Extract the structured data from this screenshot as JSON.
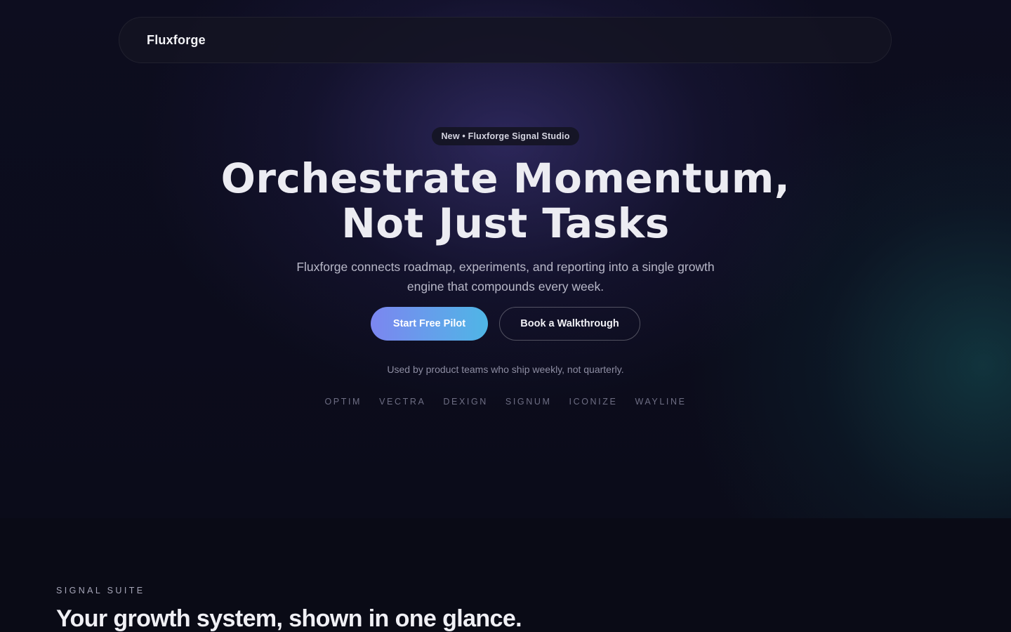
{
  "nav": {
    "brand": "Fluxforge"
  },
  "hero": {
    "badge": "New • Fluxforge Signal Studio",
    "headline_line1": "Orchestrate Momentum,",
    "headline_line2": "Not Just Tasks",
    "subcopy": "Fluxforge connects roadmap, experiments, and reporting into a single growth engine that compounds every week.",
    "primary_cta": "Start Free Pilot",
    "secondary_cta": "Book a Walkthrough",
    "trust_line": "Used by product teams who ship weekly, not quarterly.",
    "logos": [
      "OPTIM",
      "VECTRA",
      "DEXIGN",
      "SIGNUM",
      "ICONIZE",
      "WAYLINE"
    ]
  },
  "section": {
    "label": "SIGNAL SUITE",
    "title": "Your growth system, shown in one glance."
  },
  "colors": {
    "background": "#0a0b16",
    "cta_gradient_start": "#7c86f0",
    "cta_gradient_end": "#4fb6e6"
  }
}
